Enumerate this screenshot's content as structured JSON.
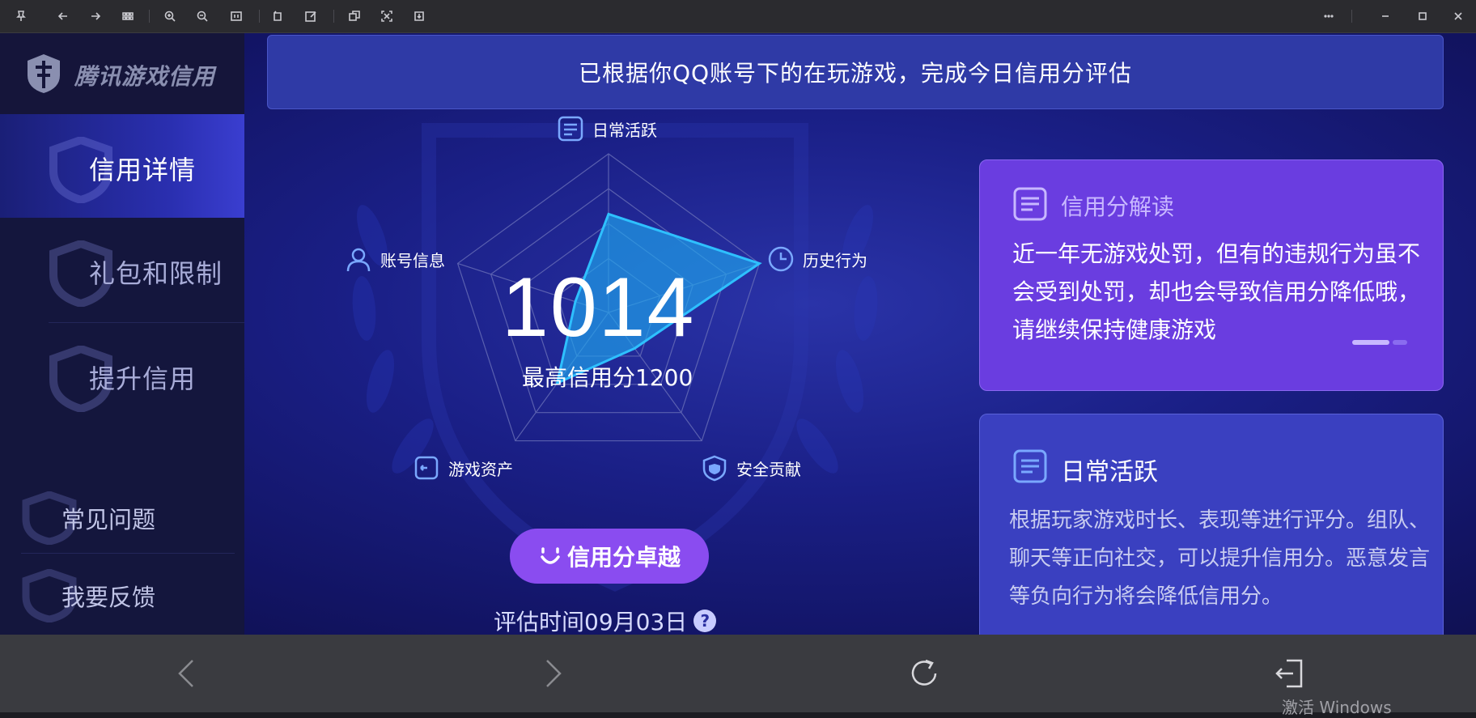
{
  "toolbar": {
    "left_icons": [
      "pin-icon",
      "back-arrow-icon",
      "forward-arrow-icon",
      "grid-icon",
      "zoom-in-icon",
      "zoom-out-icon",
      "fit-icon",
      "rotate-icon",
      "edit-icon",
      "copy-icon",
      "scan-icon",
      "save-icon"
    ],
    "right_icons": [
      "more-icon",
      "minimize-icon",
      "maximize-icon",
      "close-icon"
    ]
  },
  "brand": {
    "title": "腾讯游戏信用"
  },
  "sidebar": {
    "items": [
      {
        "label": "信用详情",
        "active": true
      },
      {
        "label": "礼包和限制",
        "active": false
      },
      {
        "label": "提升信用",
        "active": false
      }
    ],
    "sub_items": [
      {
        "label": "常见问题"
      },
      {
        "label": "我要反馈"
      }
    ]
  },
  "banner": {
    "text": "已根据你QQ账号下的在玩游戏，完成今日信用分评估"
  },
  "radar": {
    "axes": [
      {
        "label": "日常活跃",
        "icon": "document-icon",
        "value": 0.62
      },
      {
        "label": "历史行为",
        "icon": "clock-icon",
        "value": 1.0
      },
      {
        "label": "安全贡献",
        "icon": "shield-icon",
        "value": 0.28
      },
      {
        "label": "游戏资产",
        "icon": "wallet-icon",
        "value": 0.55
      },
      {
        "label": "账号信息",
        "icon": "user-icon",
        "value": 0.22
      }
    ],
    "score": "1014",
    "max_score": "最高信用分1200"
  },
  "badge": {
    "label": "信用分卓越",
    "icon": "smile-icon"
  },
  "evaluation": {
    "text": "评估时间09月03日",
    "help": "?"
  },
  "card_interpret": {
    "title": "信用分解读",
    "text": "近一年无游戏处罚，但有的违规行为虽不会受到处罚，却也会导致信用分降低哦，请继续保持健康游戏"
  },
  "card_daily": {
    "title": "日常活跃",
    "text": "根据玩家游戏时长、表现等进行评分。组队、聊天等正向社交，可以提升信用分。恶意发言等负向行为将会降低信用分。"
  },
  "bottom_nav": {
    "icons": [
      "chevron-left-icon",
      "chevron-right-icon",
      "refresh-icon",
      "exit-icon"
    ],
    "watermark": "激活 Windows"
  },
  "colors": {
    "accent_purple": "#8a4cf0",
    "card_purple": "#6a3de0",
    "radar_fill": "#1ea8f0",
    "background_blue": "#1a1f86"
  }
}
